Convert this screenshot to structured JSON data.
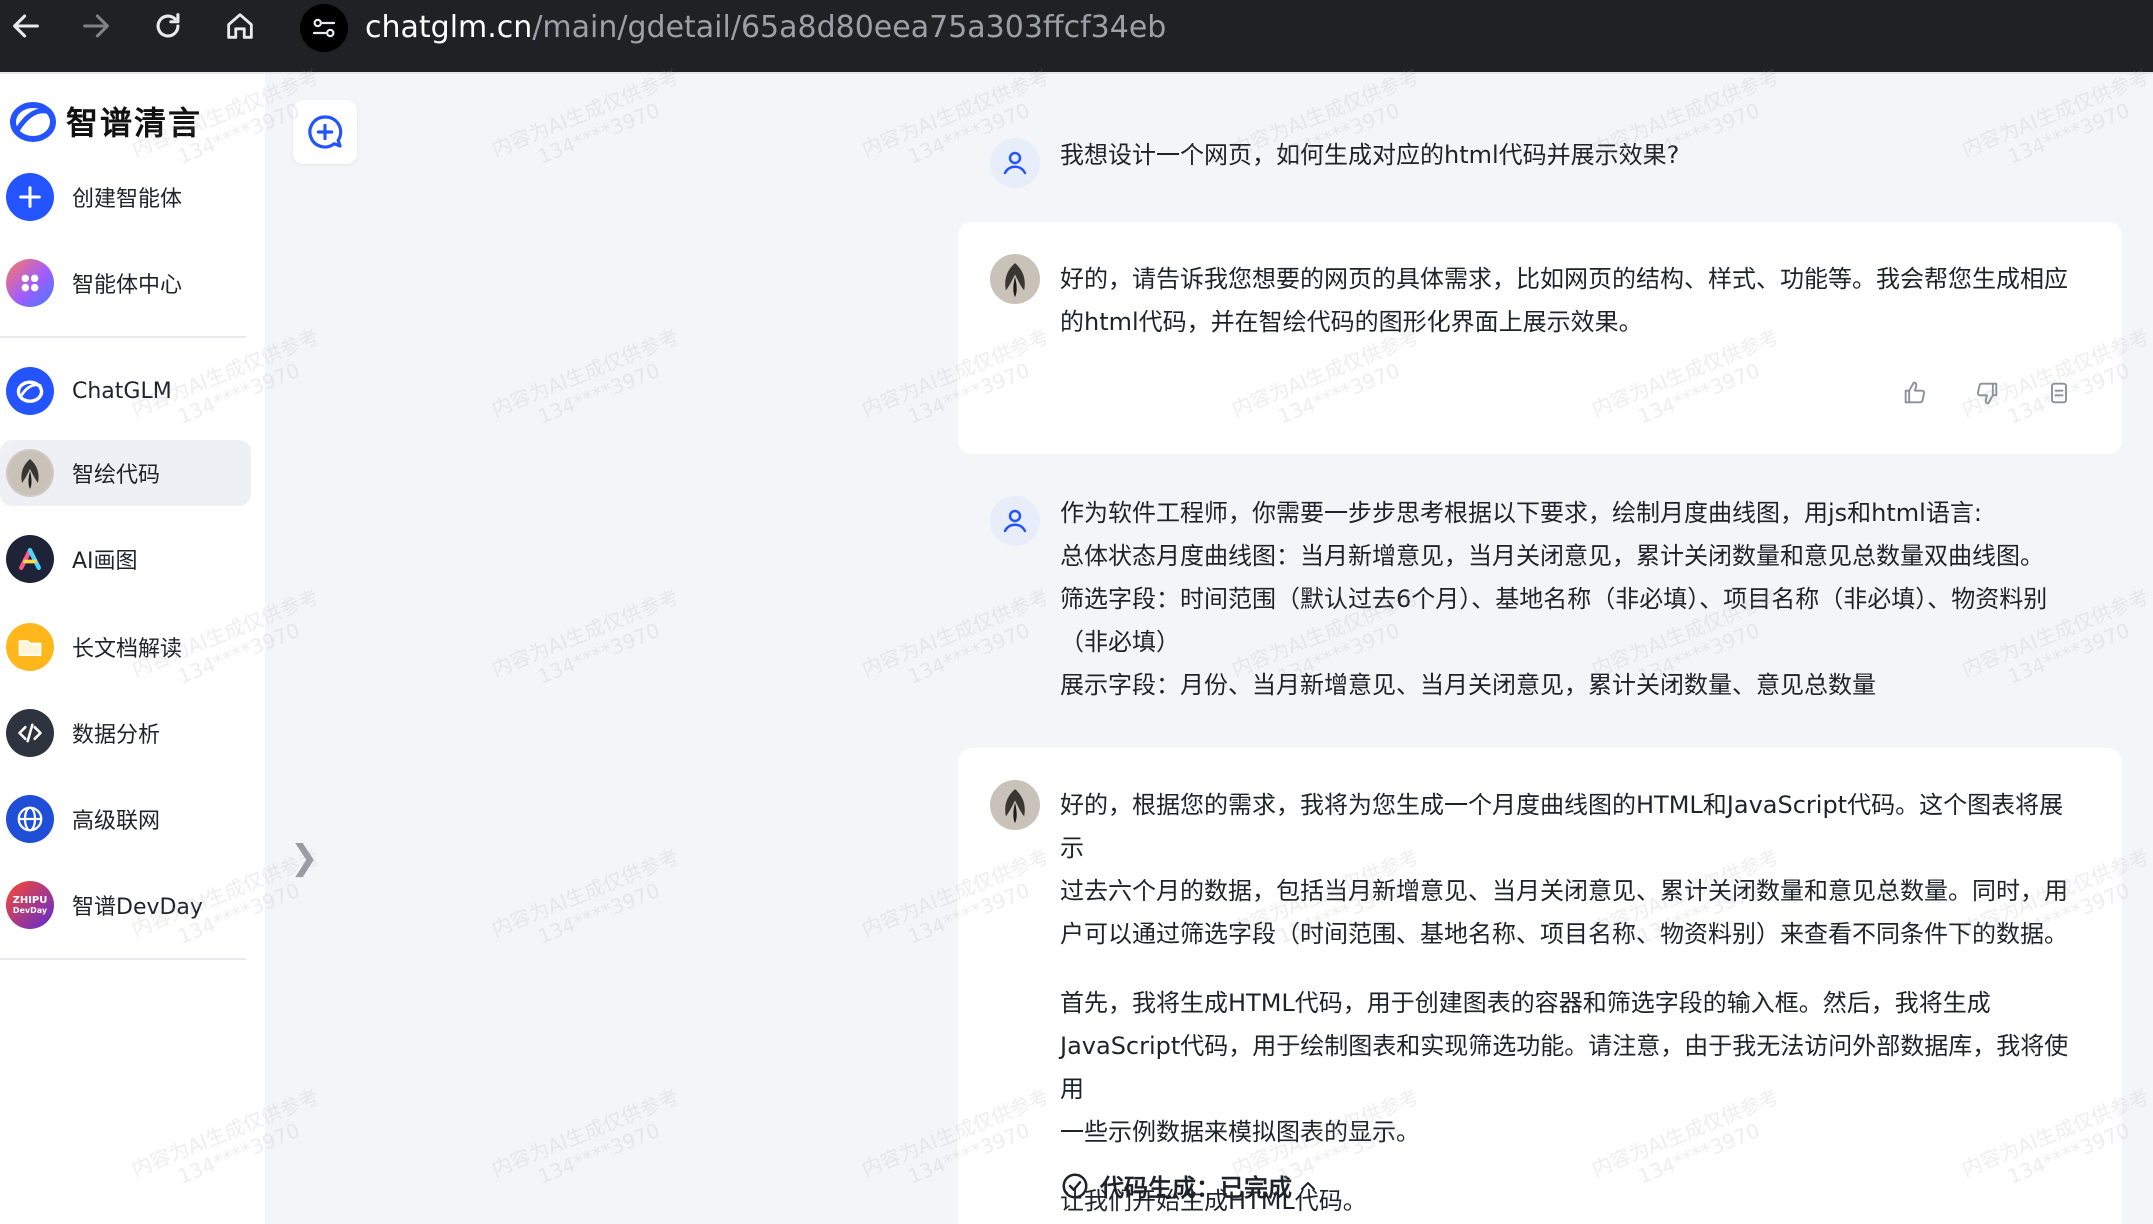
{
  "browser": {
    "url_host": "chatglm.cn",
    "url_path": "/main/gdetail/65a8d80eea75a303ffcf34eb"
  },
  "sidebar": {
    "brand": "智谱清言",
    "top_items": [
      {
        "label": "创建智能体"
      },
      {
        "label": "智能体中心"
      }
    ],
    "items": [
      {
        "label": "ChatGLM"
      },
      {
        "label": "智绘代码"
      },
      {
        "label": "AI画图"
      },
      {
        "label": "长文档解读"
      },
      {
        "label": "数据分析"
      },
      {
        "label": "高级联网"
      },
      {
        "label": "智谱DevDay"
      }
    ],
    "active_item": "智绘代码",
    "devday_logo_text": [
      "ZHIPU",
      "DevDay"
    ]
  },
  "chat": {
    "messages": [
      {
        "role": "user",
        "lines": [
          "我想设计一个网页，如何生成对应的html代码并展示效果?"
        ]
      },
      {
        "role": "assistant",
        "lines": [
          "好的，请告诉我您想要的网页的具体需求，比如网页的结构、样式、功能等。我会帮您生成相应",
          "的html代码，并在智绘代码的图形化界面上展示效果。"
        ]
      },
      {
        "role": "user",
        "lines": [
          "作为软件工程师，你需要一步步思考根据以下要求，绘制月度曲线图，用js和html语言:",
          "总体状态月度曲线图：当月新增意见，当月关闭意见，累计关闭数量和意见总数量双曲线图。",
          "筛选字段：时间范围（默认过去6个月）、基地名称（非必填）、项目名称（非必填）、物资料别",
          "（非必填）",
          "展示字段：月份、当月新增意见、当月关闭意见，累计关闭数量、意见总数量"
        ]
      },
      {
        "role": "assistant",
        "paragraphs": [
          [
            "好的，根据您的需求，我将为您生成一个月度曲线图的HTML和JavaScript代码。这个图表将展示",
            "过去六个月的数据，包括当月新增意见、当月关闭意见、累计关闭数量和意见总数量。同时，用",
            "户可以通过筛选字段（时间范围、基地名称、项目名称、物资料别）来查看不同条件下的数据。"
          ],
          [
            "首先，我将生成HTML代码，用于创建图表的容器和筛选字段的输入框。然后，我将生成",
            "JavaScript代码，用于绘制图表和实现筛选功能。请注意，由于我无法访问外部数据库，我将使用",
            "一些示例数据来模拟图表的显示。"
          ],
          [
            "让我们开始生成HTML代码。"
          ]
        ],
        "status": "代码生成：已完成"
      }
    ]
  },
  "watermark": {
    "line1": "内容为AI生成仅供参考",
    "line2": "134****3970"
  },
  "colors": {
    "accent": "#2454ff",
    "chrome_bg": "#202124",
    "page_bg": "#f4f5f9"
  }
}
